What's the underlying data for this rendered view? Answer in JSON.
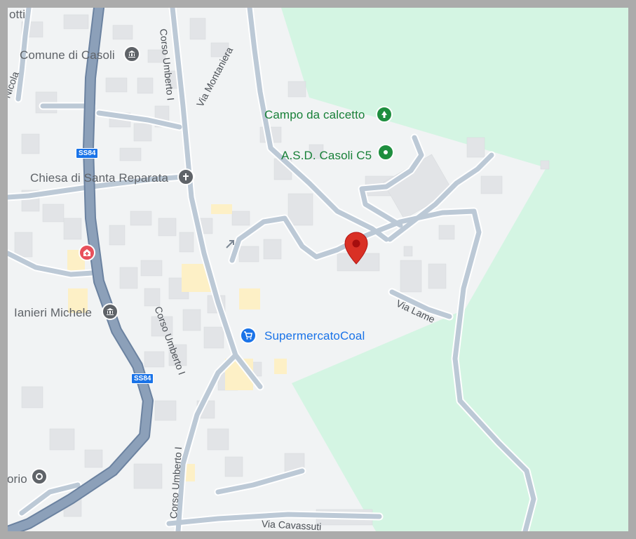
{
  "labels": {
    "comune": "Comune di Casoli",
    "chiesa": "Chiesa di Santa Reparata",
    "ianieri": "Ianieri Michele",
    "orio": "orio",
    "campo": "Campo da calcetto",
    "asd": "A.S.D. Casoli C5",
    "supermercato": "SupermercatoCoal",
    "otti": "otti",
    "nicola": "Nicola"
  },
  "streets": {
    "corso_umberto_top": "Corso Umberto I",
    "corso_umberto_mid": "Corso Umberto I",
    "corso_umberto_bottom": "Corso Umberto I",
    "via_montaniera": "Via Montaniera",
    "via_lame": "Via Lame",
    "via_cavassuti": "Via Cavassuti"
  },
  "road_badges": {
    "ss84_top": "SS84",
    "ss84_bottom": "SS84"
  },
  "icons": {
    "comune": "government-building-icon",
    "chiesa": "church-cross-icon",
    "hospital": "hospital-icon",
    "ianieri": "government-building-icon",
    "orio": "landmark-icon",
    "campo": "park-tree-icon",
    "asd": "sports-venue-icon",
    "supermercato": "shopping-cart-icon",
    "pin": "location-pin-icon"
  },
  "colors": {
    "park": "#d4f5e3",
    "major_road": "#8ca0b9",
    "minor_road": "#bcc9d6",
    "building": "#e2e4e7",
    "pin": "#d93025",
    "poi_gray": "#5f6368",
    "poi_green": "#1e8e3e",
    "poi_blue": "#1a73e8",
    "poi_red": "#e8505b"
  }
}
